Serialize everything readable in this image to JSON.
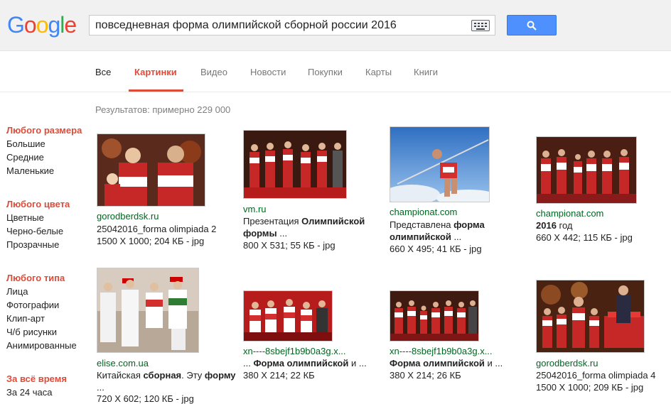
{
  "search": {
    "query": "повседневная форма олимпийской сборной россии 2016"
  },
  "logo_text": [
    "G",
    "o",
    "o",
    "g",
    "l",
    "e"
  ],
  "tabs": [
    {
      "label": "Все"
    },
    {
      "label": "Картинки"
    },
    {
      "label": "Видео"
    },
    {
      "label": "Новости"
    },
    {
      "label": "Покупки"
    },
    {
      "label": "Карты"
    },
    {
      "label": "Книги"
    }
  ],
  "results_count": "Результатов: примерно 229 000",
  "sidebar": {
    "size": {
      "title": "Любого размера",
      "items": [
        "Большие",
        "Средние",
        "Маленькие"
      ]
    },
    "color": {
      "title": "Любого цвета",
      "items": [
        "Цветные",
        "Черно-белые",
        "Прозрачные"
      ]
    },
    "type": {
      "title": "Любого типа",
      "items": [
        "Лица",
        "Фотографии",
        "Клип-арт",
        "Ч/б рисунки",
        "Анимированные"
      ]
    },
    "time": {
      "title": "За всё время",
      "items": [
        "За 24 часа"
      ]
    }
  },
  "results": [
    {
      "source": "gorodberdsk.ru",
      "caption_parts": [
        "25042016_forma olimpiada 2"
      ],
      "meta": "1500 X 1000; 204 КБ - jpg"
    },
    {
      "source": "vm.ru",
      "caption_line1": [
        "Презентация ",
        "Олимпийской"
      ],
      "caption_line2": [
        "формы",
        " ..."
      ],
      "meta": "800 X 531; 55 КБ - jpg"
    },
    {
      "source": "championat.com",
      "caption_line1": [
        "Представлена ",
        "форма"
      ],
      "caption_line2": [
        "олимпийской",
        " ..."
      ],
      "meta": "660 X 495; 41 КБ - jpg"
    },
    {
      "source": "championat.com",
      "caption_line1": [
        "2016",
        " год"
      ],
      "meta": "660 X 442; 115 КБ - jpg"
    },
    {
      "source": "elise.com.ua",
      "caption_line1": [
        "Китайская ",
        "сборная",
        ". Эту ",
        "форму"
      ],
      "caption_line2": [
        "..."
      ],
      "meta": "720 X 602; 120 КБ - jpg"
    },
    {
      "source": "xn----8sbejf1b9b0a3g.x...",
      "caption_line1": [
        "... ",
        "Форма олимпийской",
        " и ..."
      ],
      "meta": "380 X 214; 22 КБ"
    },
    {
      "source": "xn----8sbejf1b9b0a3g.x...",
      "caption_line1": [
        "Форма олимпийской",
        " и ..."
      ],
      "meta": "380 X 214; 26 КБ"
    },
    {
      "source": "gorodberdsk.ru",
      "caption_parts": [
        "25042016_forma olimpiada 4"
      ],
      "meta": "1500 X 1000; 209 КБ - jpg"
    }
  ],
  "colors": {
    "accent": "#dd4b39",
    "link_green": "#006621",
    "search_blue": "#4d90fe"
  },
  "icons": [
    "keyboard-icon",
    "search-icon"
  ]
}
